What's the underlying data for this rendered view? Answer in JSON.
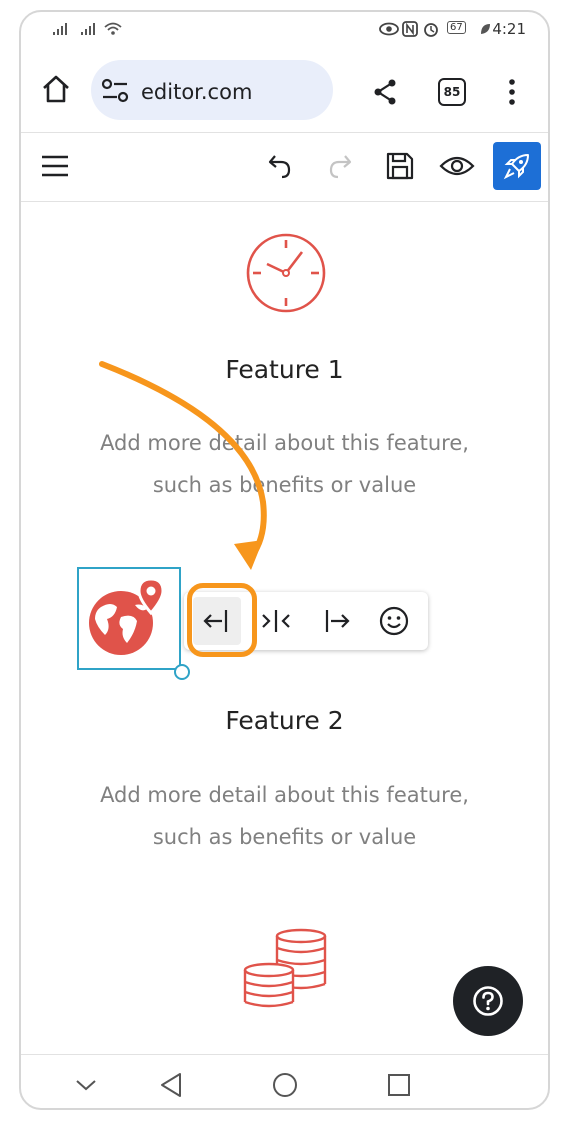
{
  "status_bar": {
    "time": "4:21",
    "battery": "67"
  },
  "browser": {
    "url": "editor.com",
    "tab_count": "85"
  },
  "features": [
    {
      "title": "Feature 1",
      "desc_line1": "Add more detail about this feature,",
      "desc_line2": "such as benefits or value"
    },
    {
      "title": "Feature 2",
      "desc_line1": "Add more detail about this feature,",
      "desc_line2": "such as benefits or value"
    }
  ],
  "colors": {
    "accent_blue": "#1d6fd6",
    "icon_red": "#e0534a",
    "highlight_orange": "#f7961c",
    "selection_blue": "#2fa3c7"
  },
  "icons": [
    "home-icon",
    "site-settings-icon",
    "share-icon",
    "more-icon",
    "menu-icon",
    "undo-icon",
    "redo-icon",
    "save-icon",
    "preview-icon",
    "publish-rocket-icon",
    "clock-icon",
    "globe-location-icon",
    "align-left-icon",
    "align-center-icon",
    "align-right-icon",
    "emoji-icon",
    "coins-icon",
    "help-icon"
  ]
}
